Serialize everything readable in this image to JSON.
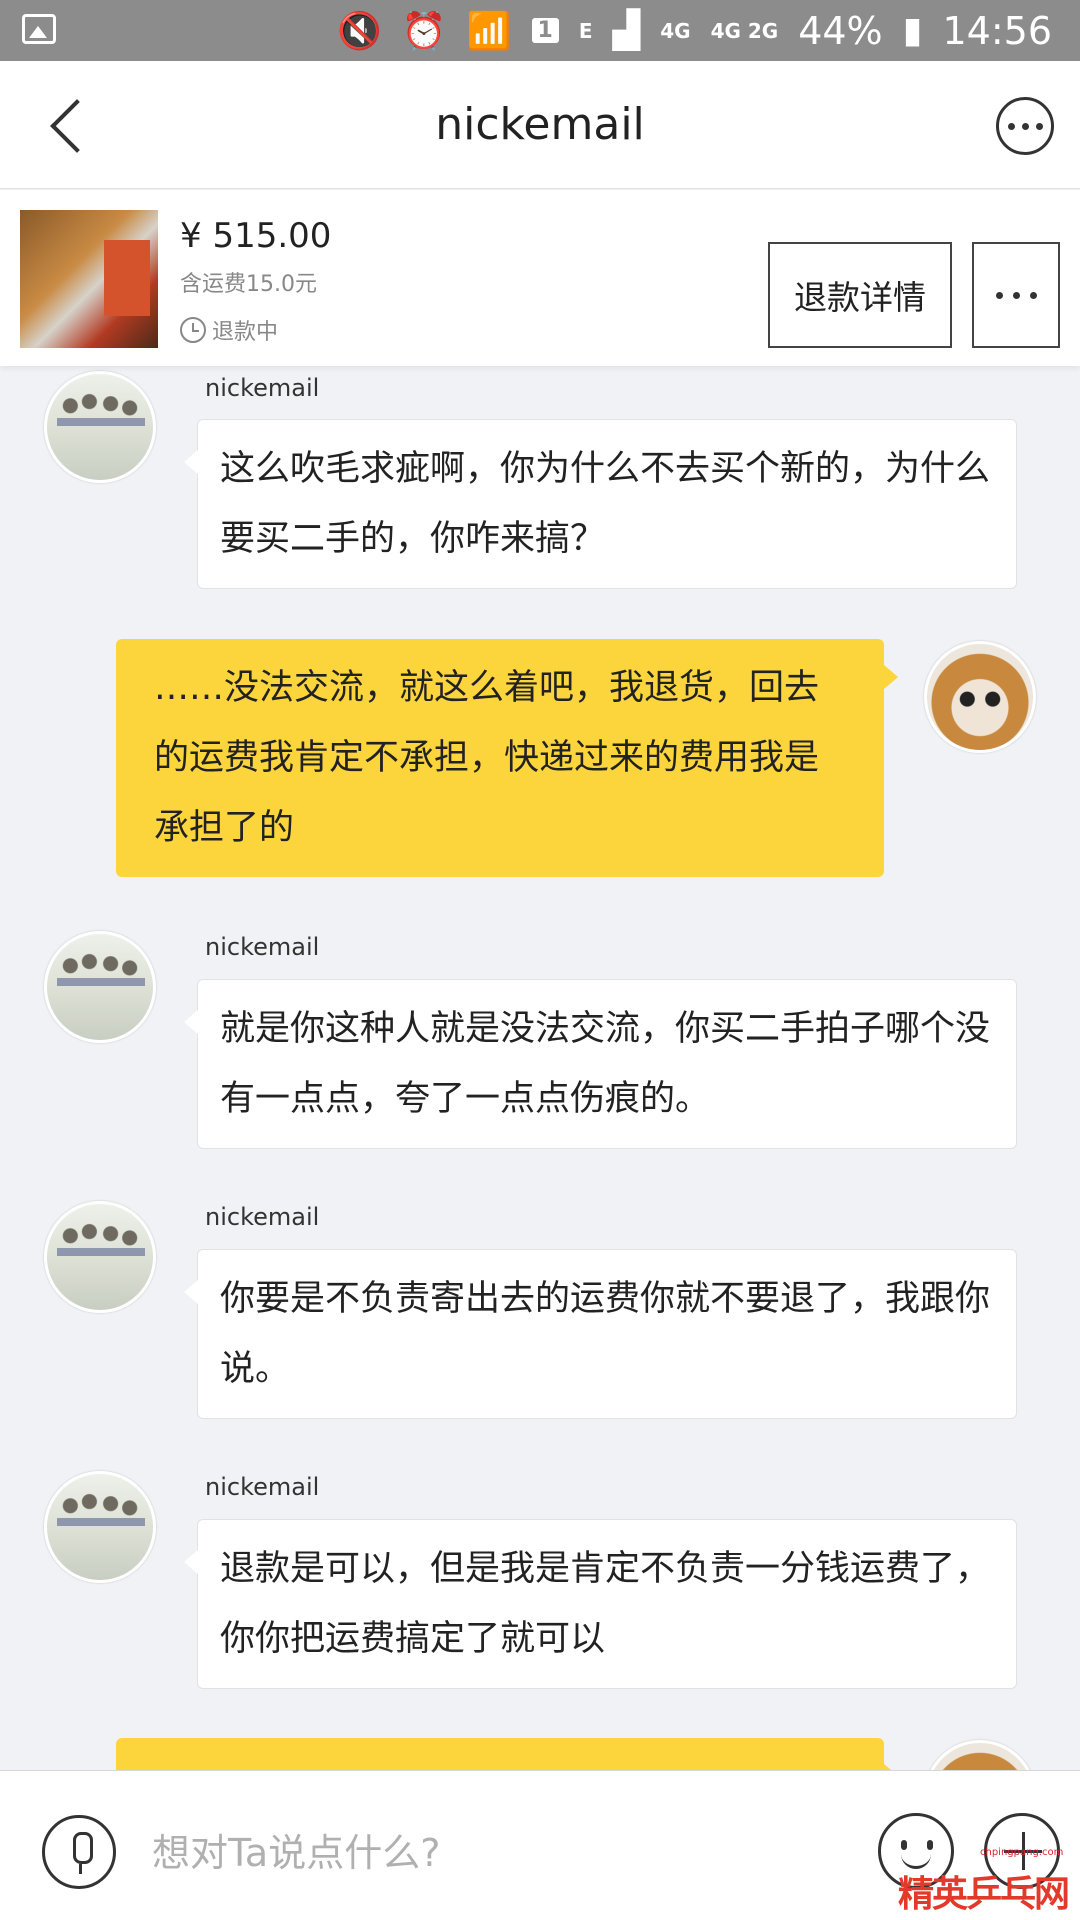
{
  "status_bar": {
    "battery_text": "44%",
    "time": "14:56",
    "sim_slot": "1",
    "network_e": "E",
    "network_4g": "4G",
    "network_4g2g": "4G 2G",
    "icons": [
      "gallery-icon",
      "mute-icon",
      "alarm-icon",
      "wifi-icon",
      "signal-icon",
      "battery-icon"
    ]
  },
  "header": {
    "title": "nickemail",
    "back_icon": "back-arrow-icon",
    "more_icon": "more-circle-icon"
  },
  "product": {
    "price": "¥ 515.00",
    "shipping": "含运费15.0元",
    "status": "退款中",
    "refund_button": "退款详情"
  },
  "messages": [
    {
      "direction": "in",
      "sender": "nickemail",
      "text": "这么吹毛求疵啊，你为什么不去买个新的，为什么要买二手的，你咋来搞？"
    },
    {
      "direction": "out",
      "text": "……没法交流，就这么着吧，我退货，回去的运费我肯定不承担，快递过来的费用我是承担了的"
    },
    {
      "direction": "in",
      "sender": "nickemail",
      "text": "就是你这种人就是没法交流，你买二手拍子哪个没有一点点，夸了一点点伤痕的。"
    },
    {
      "direction": "in",
      "sender": "nickemail",
      "text": "你要是不负责寄出去的运费你就不要退了，我跟你说。"
    },
    {
      "direction": "in",
      "sender": "nickemail",
      "text": "退款是可以，但是我是肯定不负责一分钱运费了，你你把运费搞定了就可以"
    },
    {
      "direction": "out",
      "text": ""
    }
  ],
  "input": {
    "placeholder": "想对Ta说点什么?",
    "value": ""
  },
  "watermark": {
    "url": "chpingpang.com",
    "brand": "精英乒乓网"
  },
  "colors": {
    "outgoing_bubble": "#fcd53c",
    "incoming_bubble": "#ffffff",
    "chat_background": "#f1f2f5",
    "status_bar": "#8c8c8c"
  }
}
